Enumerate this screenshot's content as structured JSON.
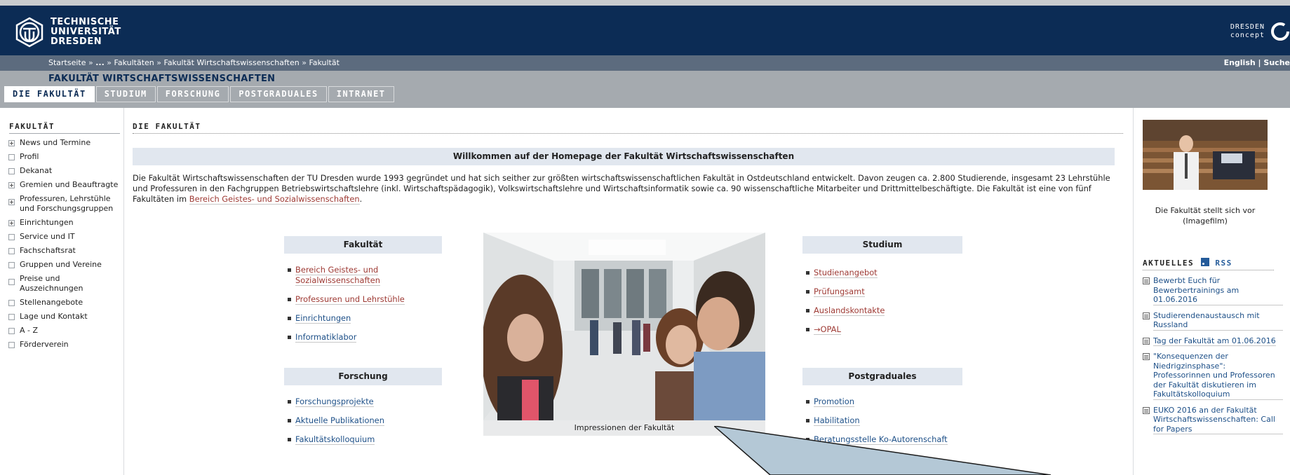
{
  "header": {
    "logo_lines": [
      "TECHNISCHE",
      "UNIVERSITÄT",
      "DRESDEN"
    ],
    "concept_lines": [
      "DRESDEN",
      "concept"
    ]
  },
  "breadcrumb": {
    "home": "Startseite",
    "sep": "»",
    "ellipsis": "...",
    "items": [
      "Fakultäten",
      "Fakultät Wirtschaftswissenschaften",
      "Fakultät"
    ],
    "lang": "English",
    "pipe": "|",
    "search": "Suche"
  },
  "faculty_title": "FAKULTÄT WIRTSCHAFTSWISSENSCHAFTEN",
  "tabs": [
    {
      "label": "DIE FAKULTÄT",
      "active": true
    },
    {
      "label": "STUDIUM",
      "active": false
    },
    {
      "label": "FORSCHUNG",
      "active": false
    },
    {
      "label": "POSTGRADUALES",
      "active": false
    },
    {
      "label": "INTRANET",
      "active": false
    }
  ],
  "sidebar": {
    "title": "FAKULTÄT",
    "items": [
      {
        "label": "News und Termine",
        "expandable": true
      },
      {
        "label": "Profil",
        "expandable": false
      },
      {
        "label": "Dekanat",
        "expandable": false
      },
      {
        "label": "Gremien und Beauftragte",
        "expandable": true
      },
      {
        "label": "Professuren, Lehrstühle und Forschungsgruppen",
        "expandable": true
      },
      {
        "label": "Einrichtungen",
        "expandable": true
      },
      {
        "label": "Service und IT",
        "expandable": false
      },
      {
        "label": "Fachschaftsrat",
        "expandable": false
      },
      {
        "label": "Gruppen und Vereine",
        "expandable": false
      },
      {
        "label": "Preise und Auszeichnungen",
        "expandable": false
      },
      {
        "label": "Stellenangebote",
        "expandable": false
      },
      {
        "label": "Lage und Kontakt",
        "expandable": false
      },
      {
        "label": "A - Z",
        "expandable": false
      },
      {
        "label": "Förderverein",
        "expandable": false
      }
    ]
  },
  "main": {
    "heading": "DIE FAKULTÄT",
    "welcome": "Willkommen auf der Homepage der Fakultät Wirtschaftswissenschaften",
    "intro_text": "Die Fakultät Wirtschaftswissenschaften der TU Dresden wurde 1993 gegründet und hat sich seither zur größten wirtschaftswissenschaftlichen Fakultät in Ostdeutschland entwickelt. Davon zeugen ca. 2.800 Studierende, insgesamt 23 Lehrstühle und Professuren in den Fachgruppen Betriebswirtschaftslehre (inkl. Wirtschaftspädagogik), Volkswirtschaftslehre und Wirtschaftsinformatik sowie ca. 90 wissenschaftliche Mitarbeiter und Drittmittelbeschäftigte. Die Fakultät ist eine von fünf Fakultäten im ",
    "intro_link": "Bereich Geistes- und Sozialwissenschaften",
    "intro_end": ".",
    "photo_caption": "Impressionen der Fakultät",
    "boxes": {
      "fakultaet": {
        "title": "Fakultät",
        "links": [
          {
            "label": "Bereich Geistes- und Sozialwissenschaften",
            "visited": true
          },
          {
            "label": "Professuren und Lehrstühle",
            "visited": true
          },
          {
            "label": "Einrichtungen",
            "visited": false
          },
          {
            "label": "Informatiklabor",
            "visited": false
          }
        ]
      },
      "forschung": {
        "title": "Forschung",
        "links": [
          {
            "label": "Forschungsprojekte",
            "visited": false
          },
          {
            "label": "Aktuelle Publikationen",
            "visited": false
          },
          {
            "label": "Fakultätskolloquium",
            "visited": false
          }
        ]
      },
      "studium": {
        "title": "Studium",
        "links": [
          {
            "label": "Studienangebot",
            "visited": true
          },
          {
            "label": "Prüfungsamt",
            "visited": true
          },
          {
            "label": "Auslandskontakte",
            "visited": true
          },
          {
            "label": "→OPAL",
            "visited": true
          }
        ]
      },
      "postgraduales": {
        "title": "Postgraduales",
        "links": [
          {
            "label": "Promotion",
            "visited": false
          },
          {
            "label": "Habilitation",
            "visited": false
          },
          {
            "label": "Beratungsstelle Ko-Autorenschaft",
            "visited": false
          }
        ]
      }
    }
  },
  "right": {
    "video_caption": "Die Fakultät stellt sich vor (Imagefilm)",
    "aktuelles_title": "AKTUELLES",
    "rss_label": "RSS",
    "news": [
      "Bewerbt Euch für Bewerbertrainings am 01.06.2016",
      "Studierendenaustausch mit Russland",
      "Tag der Fakultät am 01.06.2016",
      "\"Konsequenzen der Niedrigzinsphase\": Professorinnen und Professoren der Fakultät diskutieren im Fakultätskolloquium",
      "EUKO 2016 an der Fakultät Wirtschaftswissenschaften: Call for Papers"
    ]
  },
  "colors": {
    "header_bg": "#0c2c55",
    "crumb_bg": "#5c6b7e",
    "tab_bg": "#a5aaaf",
    "visited_link": "#9e3a34",
    "link": "#1e5088",
    "box_head": "#e1e7ef",
    "pointer": "#b4c8d6"
  }
}
